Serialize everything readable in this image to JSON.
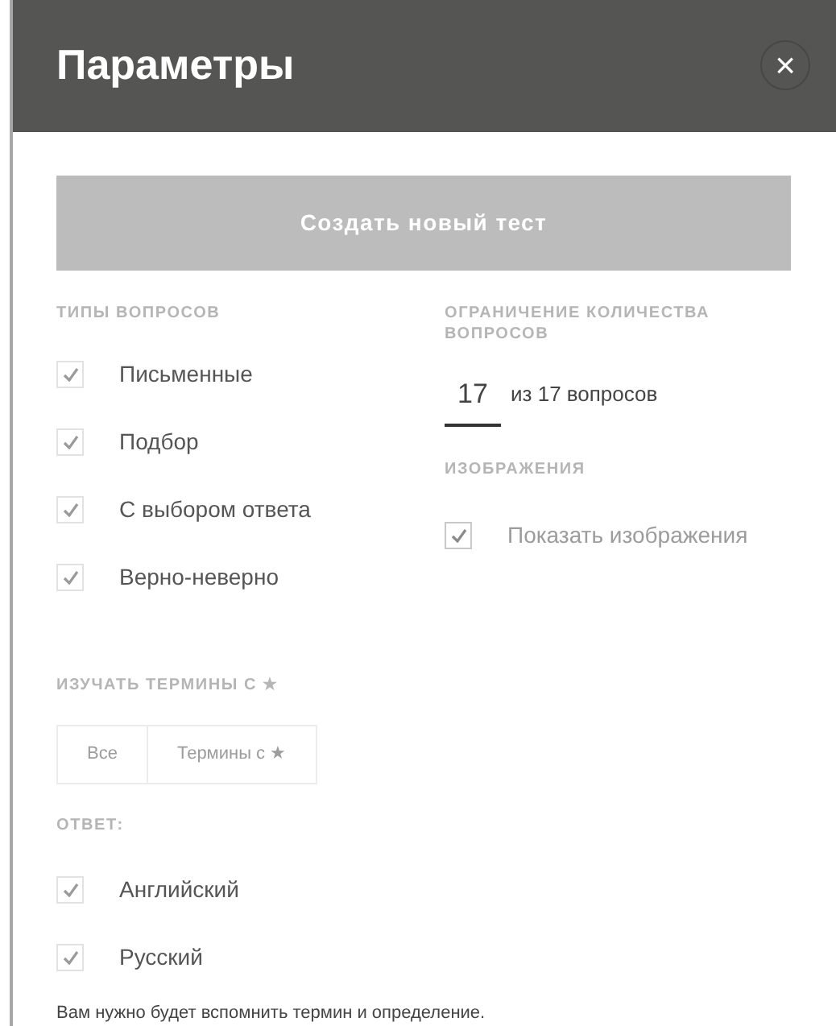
{
  "header": {
    "title": "Параметры",
    "close": "×"
  },
  "create_button": "Создать новый тест",
  "question_types": {
    "label": "ТИПЫ ВОПРОСОВ",
    "items": [
      {
        "label": "Письменные",
        "checked": true
      },
      {
        "label": "Подбор",
        "checked": true
      },
      {
        "label": "С выбором ответа",
        "checked": true
      },
      {
        "label": "Верно-неверно",
        "checked": true
      }
    ]
  },
  "question_limit": {
    "label": "ОГРАНИЧЕНИЕ КОЛИЧЕСТВА ВОПРОСОВ",
    "value": "17",
    "suffix": "из 17 вопросов"
  },
  "images": {
    "label": "ИЗОБРАЖЕНИЯ",
    "items": [
      {
        "label": "Показать изображения",
        "checked": true,
        "disabled": true
      }
    ]
  },
  "study_terms": {
    "label": "ИЗУЧАТЬ ТЕРМИНЫ С ★",
    "options": [
      {
        "label": "Все",
        "selected": false,
        "disabled": true
      },
      {
        "label": "Термины с ★",
        "selected": false,
        "disabled": true
      }
    ]
  },
  "answer": {
    "label": "ОТВЕТ:",
    "items": [
      {
        "label": "Английский",
        "checked": true,
        "disabled": false
      },
      {
        "label": "Русский",
        "checked": true,
        "disabled": false
      }
    ]
  },
  "note": "Вам нужно будет вспомнить термин и определение."
}
